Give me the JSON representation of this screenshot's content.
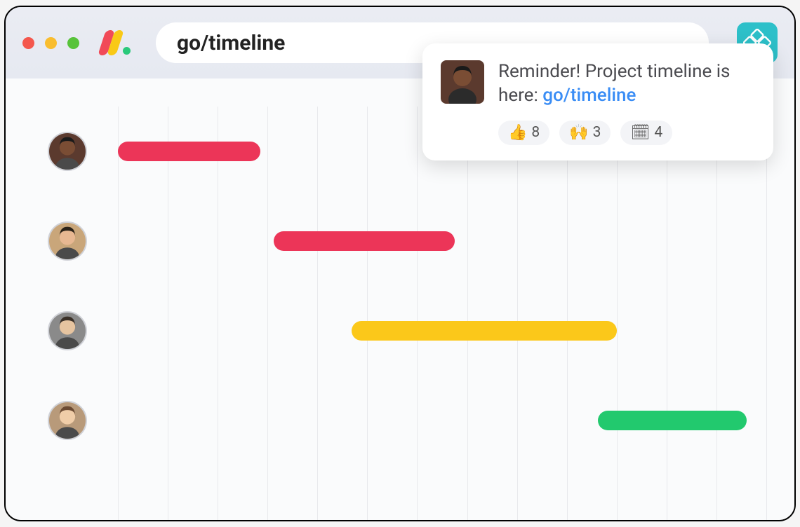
{
  "toolbar": {
    "url": "go/timeline"
  },
  "message": {
    "text_prefix": "Reminder! Project timeline is here: ",
    "link_text": "go/timeline",
    "reactions": [
      {
        "emoji": "👍",
        "count": "8"
      },
      {
        "emoji": "🙌",
        "count": "3"
      },
      {
        "emoji": "🗓",
        "count": "4"
      }
    ]
  },
  "timeline": {
    "grid_columns": 13,
    "rows": [
      {
        "avatar": "person1",
        "bar": {
          "left_pct": 0,
          "width_pct": 22,
          "color": "#ec3558"
        }
      },
      {
        "avatar": "person2",
        "bar": {
          "left_pct": 24,
          "width_pct": 28,
          "color": "#ec3558"
        }
      },
      {
        "avatar": "person3",
        "bar": {
          "left_pct": 36,
          "width_pct": 41,
          "color": "#fbc81a"
        }
      },
      {
        "avatar": "person4",
        "bar": {
          "left_pct": 74,
          "width_pct": 23,
          "color": "#22c96e"
        }
      }
    ]
  },
  "colors": {
    "red_bar": "#ec3558",
    "yellow_bar": "#fbc81a",
    "green_bar": "#22c96e",
    "link": "#3a8df5",
    "site_btn": "#2dc0c9"
  }
}
